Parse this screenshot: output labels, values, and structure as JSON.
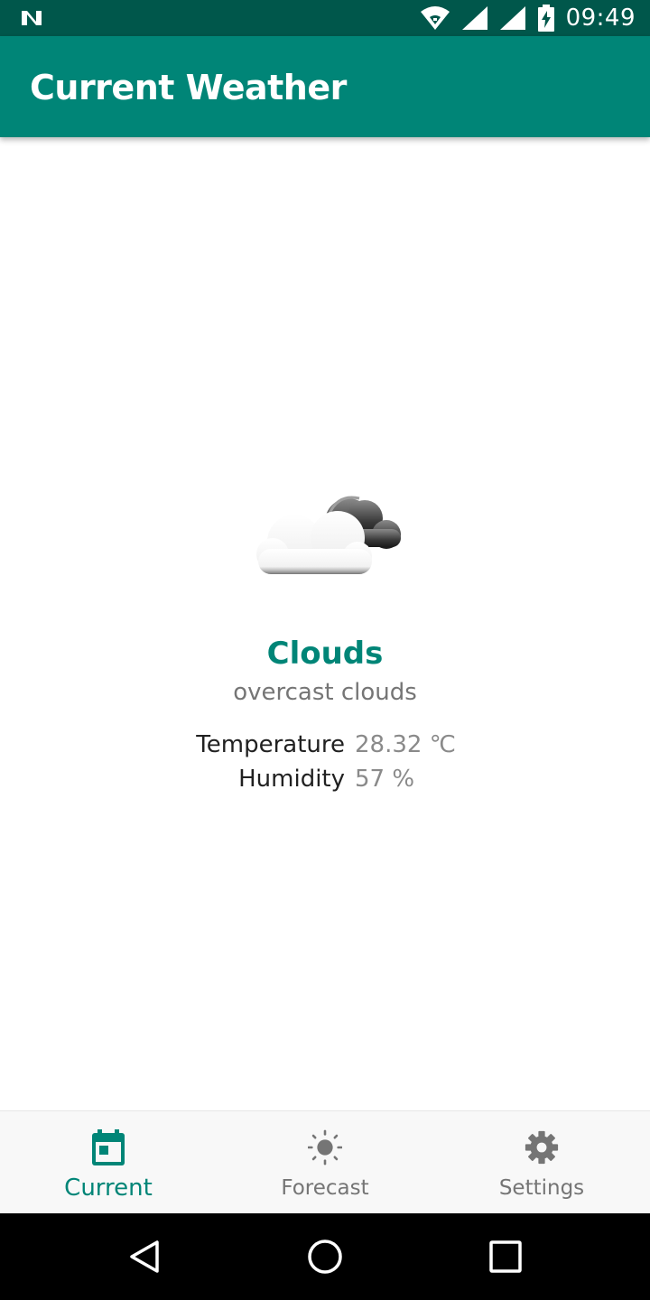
{
  "status_bar": {
    "time": "09:49",
    "icons": [
      "notification-n-icon",
      "wifi-icon",
      "signal-icon",
      "signal-icon",
      "battery-charging-icon"
    ]
  },
  "app_bar": {
    "title": "Current Weather"
  },
  "weather": {
    "icon": "cloud-icon",
    "main": "Clouds",
    "description": "overcast clouds",
    "temperature_label": "Temperature",
    "temperature_value": "28.32 ℃",
    "humidity_label": "Humidity",
    "humidity_value": "57 %"
  },
  "bottom_nav": {
    "items": [
      {
        "label": "Current",
        "icon": "calendar-icon",
        "active": true
      },
      {
        "label": "Forecast",
        "icon": "sun-icon",
        "active": false
      },
      {
        "label": "Settings",
        "icon": "gear-icon",
        "active": false
      }
    ]
  },
  "colors": {
    "status_bar": "#00574b",
    "primary": "#008577",
    "inactive": "#757575",
    "text_dark": "#212121"
  },
  "system_nav": {
    "icons": [
      "back-icon",
      "home-icon",
      "recents-icon"
    ]
  }
}
